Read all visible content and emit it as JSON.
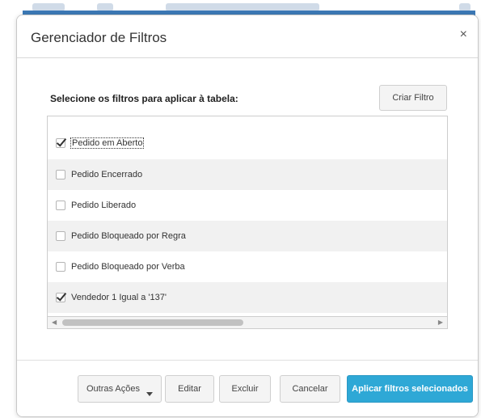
{
  "dialog": {
    "title": "Gerenciador de Filtros",
    "close_glyph": "×",
    "instruction": "Selecione os filtros para aplicar à tabela:",
    "create_filter_label": "Criar Filtro"
  },
  "filters": [
    {
      "label": "Pedido em Aberto",
      "checked": true
    },
    {
      "label": "Pedido Encerrado",
      "checked": false
    },
    {
      "label": "Pedido Liberado",
      "checked": false
    },
    {
      "label": "Pedido Bloqueado por Regra",
      "checked": false
    },
    {
      "label": "Pedido Bloqueado por Verba",
      "checked": false
    },
    {
      "label": "Vendedor 1 Igual a '137'",
      "checked": true
    }
  ],
  "footer": {
    "more_actions_label": "Outras Ações",
    "edit_label": "Editar",
    "delete_label": "Excluir",
    "cancel_label": "Cancelar",
    "apply_label": "Aplicar filtros selecionados"
  },
  "colors": {
    "primary": "#2ea8d6",
    "header_line": "#3c79b6"
  },
  "icons": {
    "close": "close-icon",
    "check": "checkmark-icon",
    "dropdown": "caret-down-icon",
    "scroll_left": "arrow-left-icon",
    "scroll_right": "arrow-right-icon"
  }
}
